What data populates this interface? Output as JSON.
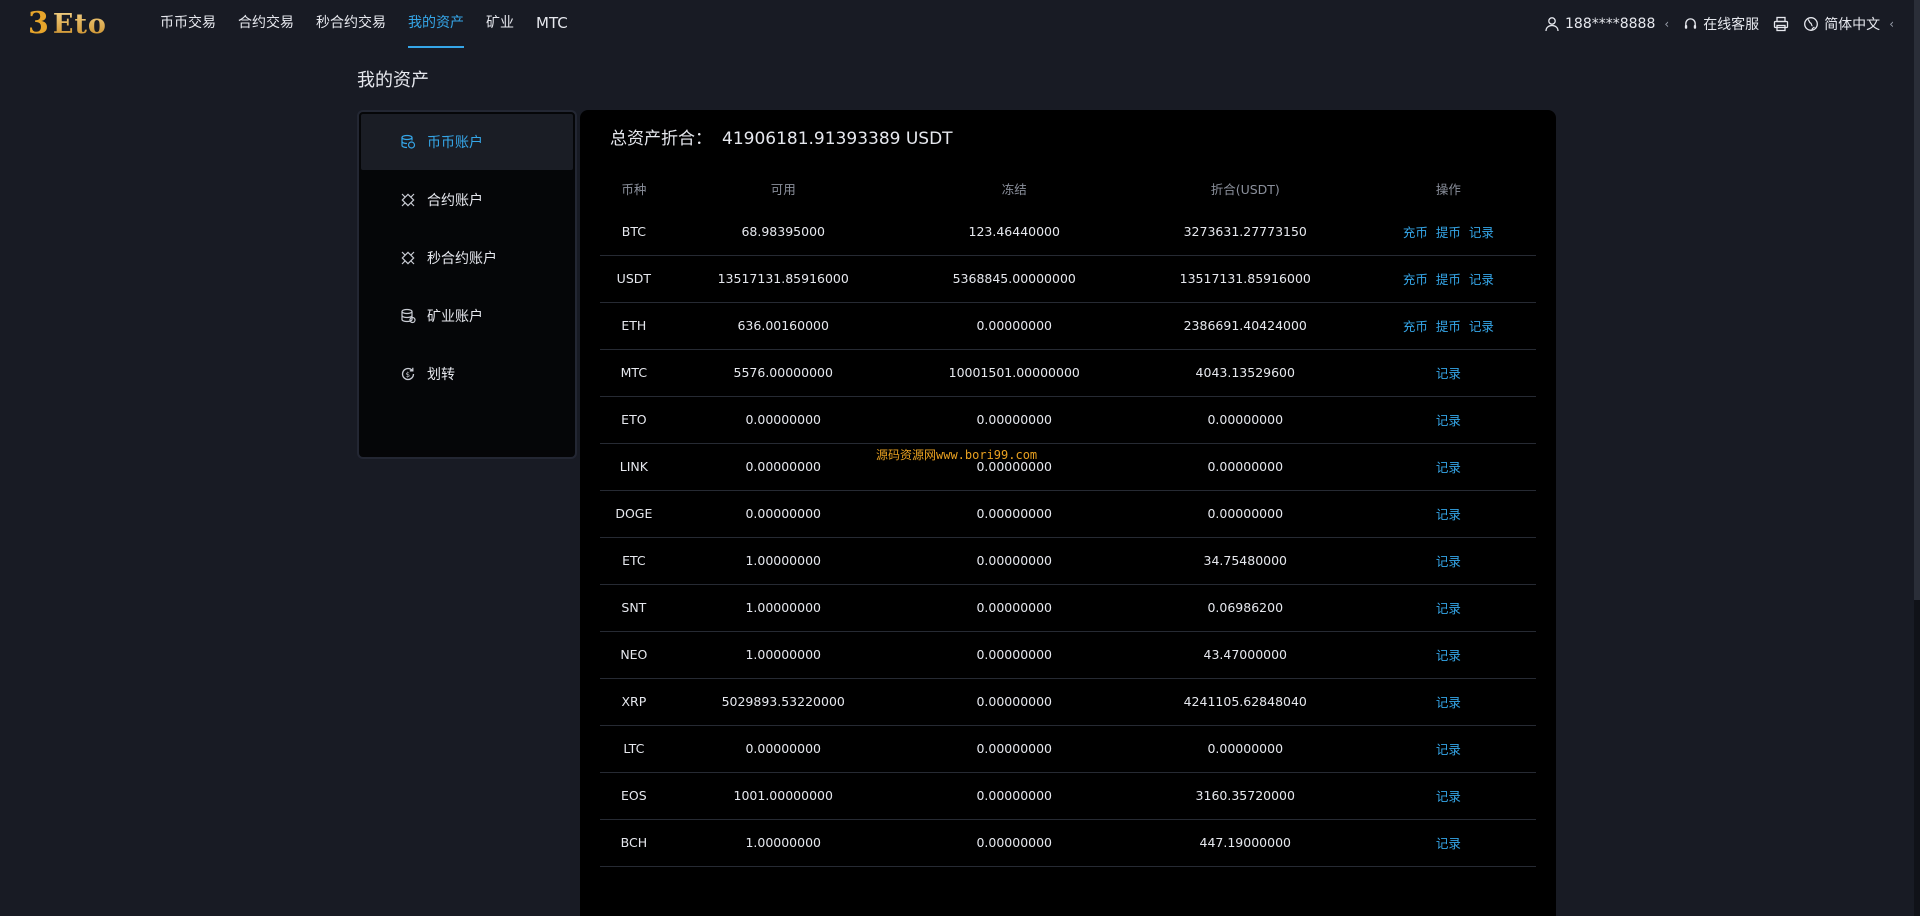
{
  "header": {
    "logo_text": "Eto",
    "logo_mark": "3",
    "nav": [
      {
        "label": "币币交易",
        "active": false
      },
      {
        "label": "合约交易",
        "active": false
      },
      {
        "label": "秒合约交易",
        "active": false
      },
      {
        "label": "我的资产",
        "active": true
      },
      {
        "label": "矿业",
        "active": false
      },
      {
        "label": "MTC",
        "active": false
      }
    ],
    "user": "188****8888",
    "service": "在线客服",
    "language": "简体中文",
    "caret": "‹"
  },
  "page_title": "我的资产",
  "sidebar": {
    "items": [
      {
        "label": "币币账户",
        "icon": "coins-icon",
        "active": true
      },
      {
        "label": "合约账户",
        "icon": "contract-icon",
        "active": false
      },
      {
        "label": "秒合约账户",
        "icon": "second-contract-icon",
        "active": false
      },
      {
        "label": "矿业账户",
        "icon": "mining-icon",
        "active": false
      },
      {
        "label": "划转",
        "icon": "transfer-icon",
        "active": false
      }
    ]
  },
  "summary": {
    "label": "总资产折合：",
    "value": "41906181.91393389 USDT"
  },
  "table": {
    "headers": [
      "币种",
      "可用",
      "冻结",
      "折合(USDT)",
      "操作"
    ],
    "action_labels": {
      "deposit": "充币",
      "withdraw": "提币",
      "record": "记录"
    },
    "rows": [
      {
        "coin": "BTC",
        "available": "68.98395000",
        "frozen": "123.46440000",
        "usdt": "3273631.27773150",
        "full_actions": true
      },
      {
        "coin": "USDT",
        "available": "13517131.85916000",
        "frozen": "5368845.00000000",
        "usdt": "13517131.85916000",
        "full_actions": true
      },
      {
        "coin": "ETH",
        "available": "636.00160000",
        "frozen": "0.00000000",
        "usdt": "2386691.40424000",
        "full_actions": true
      },
      {
        "coin": "MTC",
        "available": "5576.00000000",
        "frozen": "10001501.00000000",
        "usdt": "4043.13529600",
        "full_actions": false
      },
      {
        "coin": "ETO",
        "available": "0.00000000",
        "frozen": "0.00000000",
        "usdt": "0.00000000",
        "full_actions": false
      },
      {
        "coin": "LINK",
        "available": "0.00000000",
        "frozen": "0.00000000",
        "usdt": "0.00000000",
        "full_actions": false
      },
      {
        "coin": "DOGE",
        "available": "0.00000000",
        "frozen": "0.00000000",
        "usdt": "0.00000000",
        "full_actions": false
      },
      {
        "coin": "ETC",
        "available": "1.00000000",
        "frozen": "0.00000000",
        "usdt": "34.75480000",
        "full_actions": false
      },
      {
        "coin": "SNT",
        "available": "1.00000000",
        "frozen": "0.00000000",
        "usdt": "0.06986200",
        "full_actions": false
      },
      {
        "coin": "NEO",
        "available": "1.00000000",
        "frozen": "0.00000000",
        "usdt": "43.47000000",
        "full_actions": false
      },
      {
        "coin": "XRP",
        "available": "5029893.53220000",
        "frozen": "0.00000000",
        "usdt": "4241105.62848040",
        "full_actions": false
      },
      {
        "coin": "LTC",
        "available": "0.00000000",
        "frozen": "0.00000000",
        "usdt": "0.00000000",
        "full_actions": false
      },
      {
        "coin": "EOS",
        "available": "1001.00000000",
        "frozen": "0.00000000",
        "usdt": "3160.35720000",
        "full_actions": false
      },
      {
        "coin": "BCH",
        "available": "1.00000000",
        "frozen": "0.00000000",
        "usdt": "447.19000000",
        "full_actions": false
      }
    ]
  },
  "watermark": "源码资源网www.bori99.com",
  "colors": {
    "accent": "#35a6e8",
    "background": "#181b24",
    "panel": "#000000",
    "logo_gold": "#e7a52b"
  }
}
